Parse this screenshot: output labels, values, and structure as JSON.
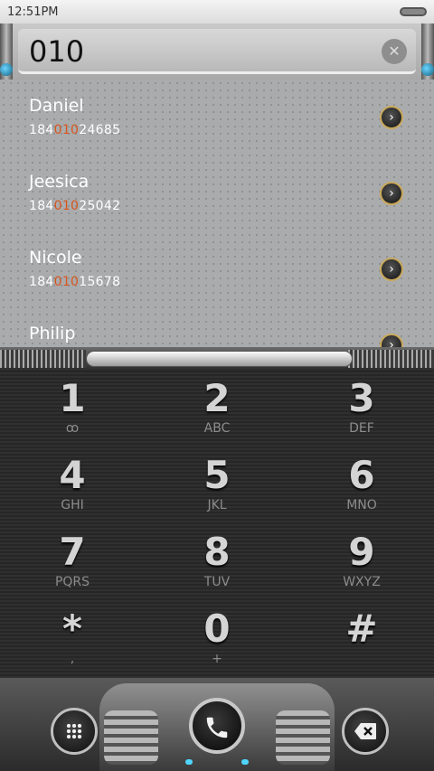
{
  "status_bar": {
    "time": "12:51PM"
  },
  "search": {
    "query": "010",
    "clear_symbol": "✕"
  },
  "contacts": [
    {
      "name": "Daniel",
      "number_prefix": "184",
      "number_match": "010",
      "number_suffix": "24685"
    },
    {
      "name": "Jeesica",
      "number_prefix": "184",
      "number_match": "010",
      "number_suffix": "25042"
    },
    {
      "name": "Nicole",
      "number_prefix": "184",
      "number_match": "010",
      "number_suffix": "15678"
    },
    {
      "name": "Philip",
      "number_prefix": "",
      "number_match": "",
      "number_suffix": ""
    }
  ],
  "keypad": [
    {
      "digit": "1",
      "letters": "ꝏ"
    },
    {
      "digit": "2",
      "letters": "ABC"
    },
    {
      "digit": "3",
      "letters": "DEF"
    },
    {
      "digit": "4",
      "letters": "GHI"
    },
    {
      "digit": "5",
      "letters": "JKL"
    },
    {
      "digit": "6",
      "letters": "MNO"
    },
    {
      "digit": "7",
      "letters": "PQRS"
    },
    {
      "digit": "8",
      "letters": "TUV"
    },
    {
      "digit": "9",
      "letters": "WXYZ"
    },
    {
      "digit": "*",
      "letters": ","
    },
    {
      "digit": "0",
      "letters": "+"
    },
    {
      "digit": "#",
      "letters": ""
    }
  ],
  "colors": {
    "match_highlight": "#d8561d",
    "led": "#4fd6ff"
  },
  "icons": {
    "dialpad": "dialpad-grid-icon",
    "call": "phone-icon",
    "backspace": "backspace-icon",
    "arrow": "chevron-right-icon"
  }
}
